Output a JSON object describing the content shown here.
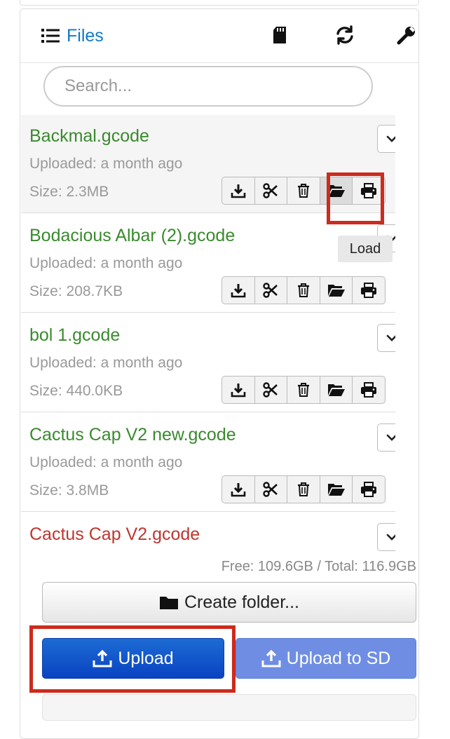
{
  "header": {
    "title": "Files",
    "icons": [
      "list-icon",
      "sd-card-icon",
      "refresh-icon",
      "wrench-icon"
    ]
  },
  "search": {
    "placeholder": "Search...",
    "value": ""
  },
  "files": [
    {
      "name": "Backmal.gcode",
      "uploaded": "Uploaded: a month ago",
      "size": "Size: 2.3MB",
      "status": "ok",
      "selected": true
    },
    {
      "name": "Bodacious Albar (2).gcode",
      "uploaded": "Uploaded: a month ago",
      "size": "Size: 208.7KB",
      "status": "ok"
    },
    {
      "name": "bol 1.gcode",
      "uploaded": "Uploaded: a month ago",
      "size": "Size: 440.0KB",
      "status": "ok"
    },
    {
      "name": "Cactus Cap V2 new.gcode",
      "uploaded": "Uploaded: a month ago",
      "size": "Size: 3.8MB",
      "status": "ok"
    },
    {
      "name": "Cactus Cap V2.gcode",
      "status": "error"
    }
  ],
  "file_actions": [
    "download-icon",
    "scissors-icon",
    "trash-icon",
    "folder-open-icon",
    "print-icon"
  ],
  "tooltip": "Load",
  "storage": {
    "info": "Free: 109.6GB / Total: 116.9GB"
  },
  "buttons": {
    "create_folder": "Create folder...",
    "upload": "Upload",
    "upload_sd": "Upload to SD"
  },
  "colors": {
    "link": "#0e7ac9",
    "file_ok": "#3a8a2e",
    "file_error": "#bd362f",
    "primary": "#0a43c2",
    "highlight": "#cc2b1d"
  }
}
